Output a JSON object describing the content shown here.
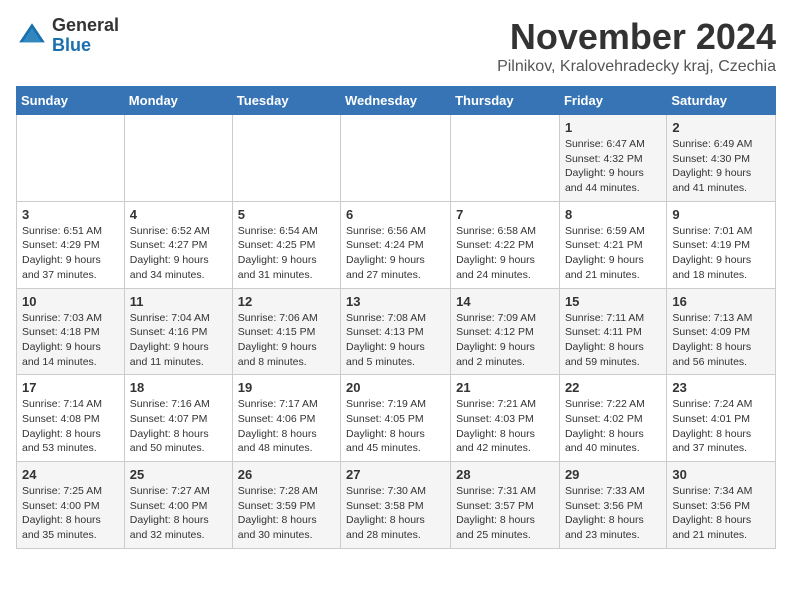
{
  "logo": {
    "general": "General",
    "blue": "Blue"
  },
  "title": {
    "month_year": "November 2024",
    "location": "Pilnikov, Kralovehradecky kraj, Czechia"
  },
  "weekdays": [
    "Sunday",
    "Monday",
    "Tuesday",
    "Wednesday",
    "Thursday",
    "Friday",
    "Saturday"
  ],
  "weeks": [
    [
      {
        "day": "",
        "info": ""
      },
      {
        "day": "",
        "info": ""
      },
      {
        "day": "",
        "info": ""
      },
      {
        "day": "",
        "info": ""
      },
      {
        "day": "",
        "info": ""
      },
      {
        "day": "1",
        "info": "Sunrise: 6:47 AM\nSunset: 4:32 PM\nDaylight: 9 hours\nand 44 minutes."
      },
      {
        "day": "2",
        "info": "Sunrise: 6:49 AM\nSunset: 4:30 PM\nDaylight: 9 hours\nand 41 minutes."
      }
    ],
    [
      {
        "day": "3",
        "info": "Sunrise: 6:51 AM\nSunset: 4:29 PM\nDaylight: 9 hours\nand 37 minutes."
      },
      {
        "day": "4",
        "info": "Sunrise: 6:52 AM\nSunset: 4:27 PM\nDaylight: 9 hours\nand 34 minutes."
      },
      {
        "day": "5",
        "info": "Sunrise: 6:54 AM\nSunset: 4:25 PM\nDaylight: 9 hours\nand 31 minutes."
      },
      {
        "day": "6",
        "info": "Sunrise: 6:56 AM\nSunset: 4:24 PM\nDaylight: 9 hours\nand 27 minutes."
      },
      {
        "day": "7",
        "info": "Sunrise: 6:58 AM\nSunset: 4:22 PM\nDaylight: 9 hours\nand 24 minutes."
      },
      {
        "day": "8",
        "info": "Sunrise: 6:59 AM\nSunset: 4:21 PM\nDaylight: 9 hours\nand 21 minutes."
      },
      {
        "day": "9",
        "info": "Sunrise: 7:01 AM\nSunset: 4:19 PM\nDaylight: 9 hours\nand 18 minutes."
      }
    ],
    [
      {
        "day": "10",
        "info": "Sunrise: 7:03 AM\nSunset: 4:18 PM\nDaylight: 9 hours\nand 14 minutes."
      },
      {
        "day": "11",
        "info": "Sunrise: 7:04 AM\nSunset: 4:16 PM\nDaylight: 9 hours\nand 11 minutes."
      },
      {
        "day": "12",
        "info": "Sunrise: 7:06 AM\nSunset: 4:15 PM\nDaylight: 9 hours\nand 8 minutes."
      },
      {
        "day": "13",
        "info": "Sunrise: 7:08 AM\nSunset: 4:13 PM\nDaylight: 9 hours\nand 5 minutes."
      },
      {
        "day": "14",
        "info": "Sunrise: 7:09 AM\nSunset: 4:12 PM\nDaylight: 9 hours\nand 2 minutes."
      },
      {
        "day": "15",
        "info": "Sunrise: 7:11 AM\nSunset: 4:11 PM\nDaylight: 8 hours\nand 59 minutes."
      },
      {
        "day": "16",
        "info": "Sunrise: 7:13 AM\nSunset: 4:09 PM\nDaylight: 8 hours\nand 56 minutes."
      }
    ],
    [
      {
        "day": "17",
        "info": "Sunrise: 7:14 AM\nSunset: 4:08 PM\nDaylight: 8 hours\nand 53 minutes."
      },
      {
        "day": "18",
        "info": "Sunrise: 7:16 AM\nSunset: 4:07 PM\nDaylight: 8 hours\nand 50 minutes."
      },
      {
        "day": "19",
        "info": "Sunrise: 7:17 AM\nSunset: 4:06 PM\nDaylight: 8 hours\nand 48 minutes."
      },
      {
        "day": "20",
        "info": "Sunrise: 7:19 AM\nSunset: 4:05 PM\nDaylight: 8 hours\nand 45 minutes."
      },
      {
        "day": "21",
        "info": "Sunrise: 7:21 AM\nSunset: 4:03 PM\nDaylight: 8 hours\nand 42 minutes."
      },
      {
        "day": "22",
        "info": "Sunrise: 7:22 AM\nSunset: 4:02 PM\nDaylight: 8 hours\nand 40 minutes."
      },
      {
        "day": "23",
        "info": "Sunrise: 7:24 AM\nSunset: 4:01 PM\nDaylight: 8 hours\nand 37 minutes."
      }
    ],
    [
      {
        "day": "24",
        "info": "Sunrise: 7:25 AM\nSunset: 4:00 PM\nDaylight: 8 hours\nand 35 minutes."
      },
      {
        "day": "25",
        "info": "Sunrise: 7:27 AM\nSunset: 4:00 PM\nDaylight: 8 hours\nand 32 minutes."
      },
      {
        "day": "26",
        "info": "Sunrise: 7:28 AM\nSunset: 3:59 PM\nDaylight: 8 hours\nand 30 minutes."
      },
      {
        "day": "27",
        "info": "Sunrise: 7:30 AM\nSunset: 3:58 PM\nDaylight: 8 hours\nand 28 minutes."
      },
      {
        "day": "28",
        "info": "Sunrise: 7:31 AM\nSunset: 3:57 PM\nDaylight: 8 hours\nand 25 minutes."
      },
      {
        "day": "29",
        "info": "Sunrise: 7:33 AM\nSunset: 3:56 PM\nDaylight: 8 hours\nand 23 minutes."
      },
      {
        "day": "30",
        "info": "Sunrise: 7:34 AM\nSunset: 3:56 PM\nDaylight: 8 hours\nand 21 minutes."
      }
    ]
  ]
}
